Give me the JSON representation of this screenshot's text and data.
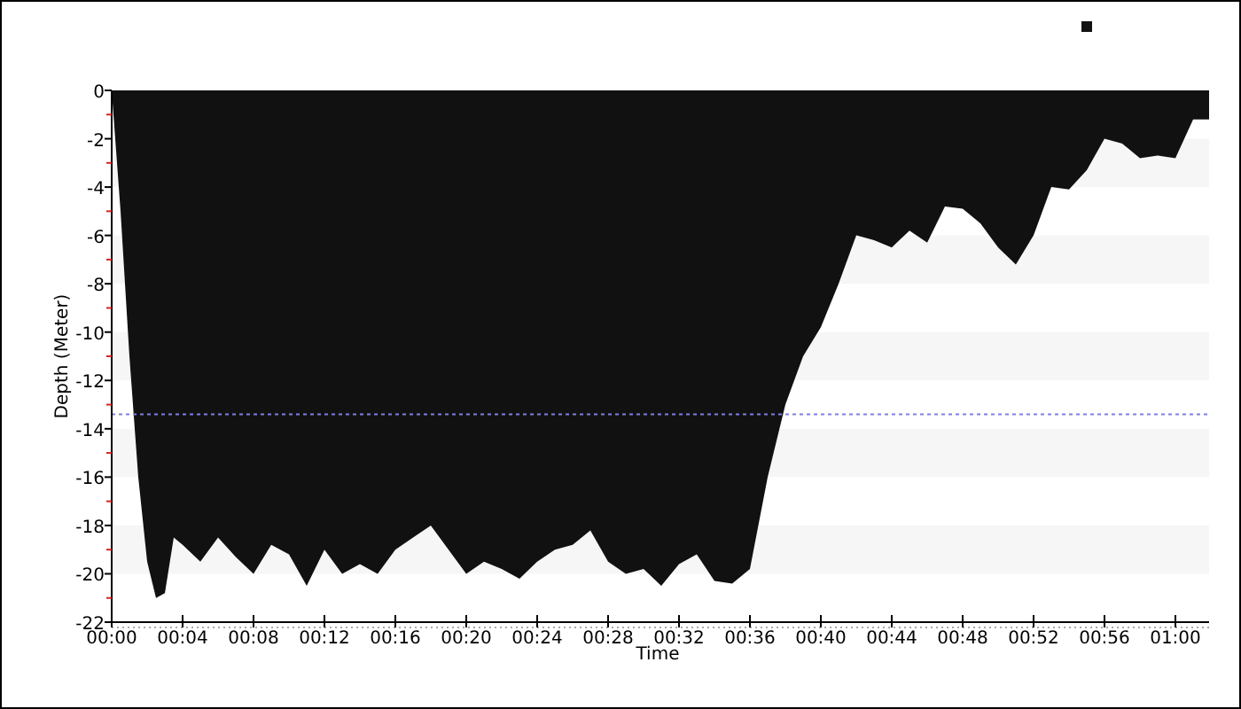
{
  "chart": {
    "chart_data": {
      "type": "area",
      "xlabel": "Time",
      "ylabel": "Depth (Meter)",
      "xlim": [
        0,
        61.9
      ],
      "ylim": [
        -22,
        0
      ],
      "x": [
        0,
        0.5,
        1,
        1.5,
        2,
        2.5,
        3,
        3.5,
        4,
        5,
        6,
        7,
        8,
        9,
        10,
        11,
        12,
        13,
        14,
        15,
        16,
        17,
        18,
        19,
        20,
        21,
        22,
        23,
        24,
        25,
        26,
        27,
        28,
        29,
        30,
        31,
        32,
        33,
        34,
        35,
        36,
        37,
        38,
        39,
        40,
        41,
        42,
        43,
        44,
        45,
        46,
        47,
        48,
        49,
        50,
        51,
        52,
        53,
        54,
        55,
        56,
        57,
        58,
        59,
        60,
        61,
        61.9
      ],
      "series": [
        {
          "color": "#111111",
          "values": [
            0,
            -5,
            -11,
            -16,
            -19.5,
            -21,
            -20.8,
            -18.5,
            -18.8,
            -19.5,
            -18.5,
            -19.3,
            -20,
            -18.8,
            -19.2,
            -20.5,
            -19,
            -20,
            -19.6,
            -20,
            -19,
            -18.5,
            -18,
            -19,
            -20,
            -19.5,
            -19.8,
            -20.2,
            -19.5,
            -19,
            -18.8,
            -18.2,
            -19.5,
            -20,
            -19.8,
            -20.5,
            -19.6,
            -19.2,
            -20.3,
            -20.4,
            -19.8,
            -16,
            -13,
            -11,
            -9.8,
            -8,
            -6,
            -6.2,
            -6.5,
            -5.8,
            -6.3,
            -4.8,
            -4.9,
            -5.5,
            -6.5,
            -7.2,
            -6,
            -4,
            -4.1,
            -3.3,
            -2,
            -2.2,
            -2.8,
            -2.7,
            -2.8,
            -1.2,
            -1.2
          ]
        }
      ],
      "xticks": [
        {
          "value": 0,
          "label": "00:00"
        },
        {
          "value": 4,
          "label": "00:04"
        },
        {
          "value": 8,
          "label": "00:08"
        },
        {
          "value": 12,
          "label": "00:12"
        },
        {
          "value": 16,
          "label": "00:16"
        },
        {
          "value": 20,
          "label": "00:20"
        },
        {
          "value": 24,
          "label": "00:24"
        },
        {
          "value": 28,
          "label": "00:28"
        },
        {
          "value": 32,
          "label": "00:32"
        },
        {
          "value": 36,
          "label": "00:36"
        },
        {
          "value": 40,
          "label": "00:40"
        },
        {
          "value": 44,
          "label": "00:44"
        },
        {
          "value": 48,
          "label": "00:48"
        },
        {
          "value": 52,
          "label": "00:52"
        },
        {
          "value": 56,
          "label": "00:56"
        },
        {
          "value": 60,
          "label": "01:00"
        }
      ],
      "yticks": [
        0,
        -2,
        -4,
        -6,
        -8,
        -10,
        -12,
        -14,
        -16,
        -18,
        -20,
        -22
      ],
      "ref_lines": [
        {
          "axis": "y",
          "value": -13.4,
          "color": "#8080e0"
        }
      ]
    }
  }
}
